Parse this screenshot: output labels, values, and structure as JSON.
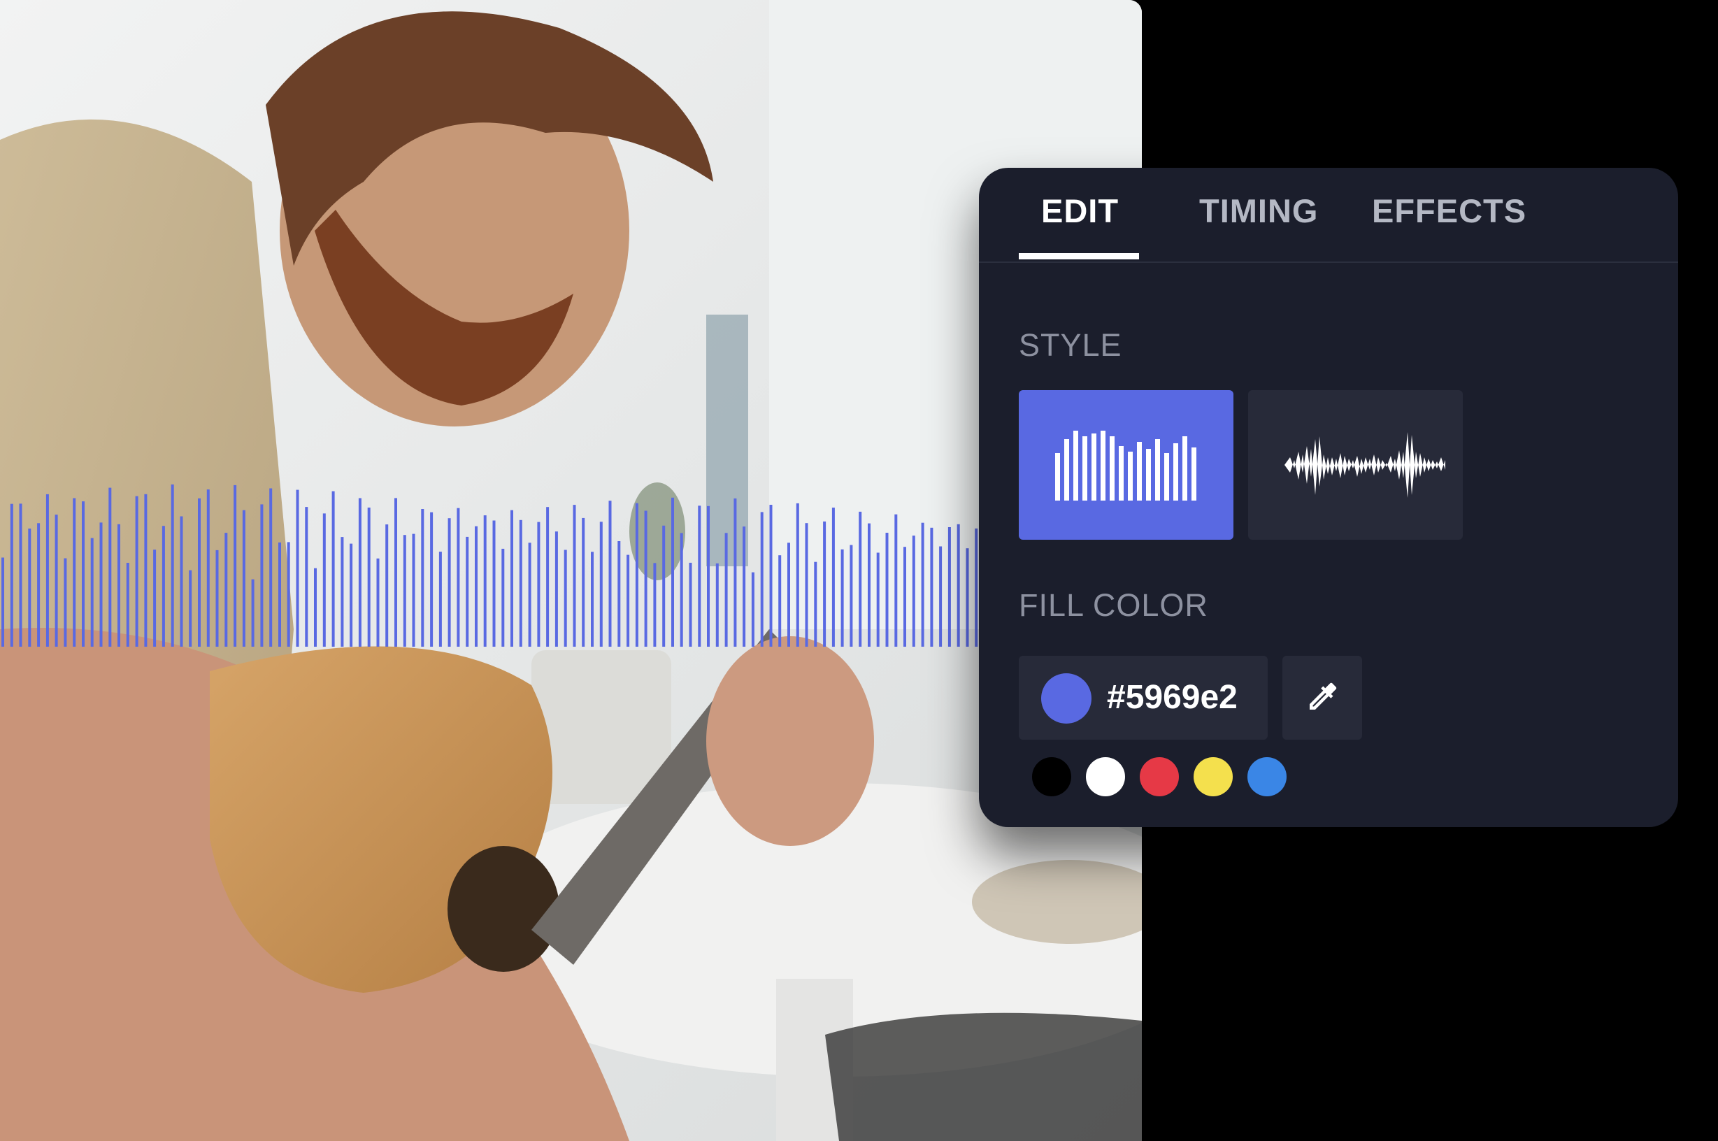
{
  "tabs": [
    {
      "label": "EDIT",
      "active": true
    },
    {
      "label": "TIMING",
      "active": false
    },
    {
      "label": "EFFECTS",
      "active": false
    }
  ],
  "style_section": {
    "label": "STYLE",
    "options": [
      {
        "name": "bars",
        "icon": "bars-waveform-icon",
        "selected": true
      },
      {
        "name": "wave",
        "icon": "wave-waveform-icon",
        "selected": false
      }
    ]
  },
  "fill_color": {
    "label": "FILL COLOR",
    "value": "#5969e2",
    "eyedropper_icon": "eyedropper-icon",
    "presets": [
      "#000000",
      "#ffffff",
      "#e63946",
      "#f4e04d",
      "#3a86e6"
    ]
  },
  "colors": {
    "accent": "#5969e2",
    "panel_bg": "#1b1e2c",
    "control_bg": "#272a39"
  }
}
